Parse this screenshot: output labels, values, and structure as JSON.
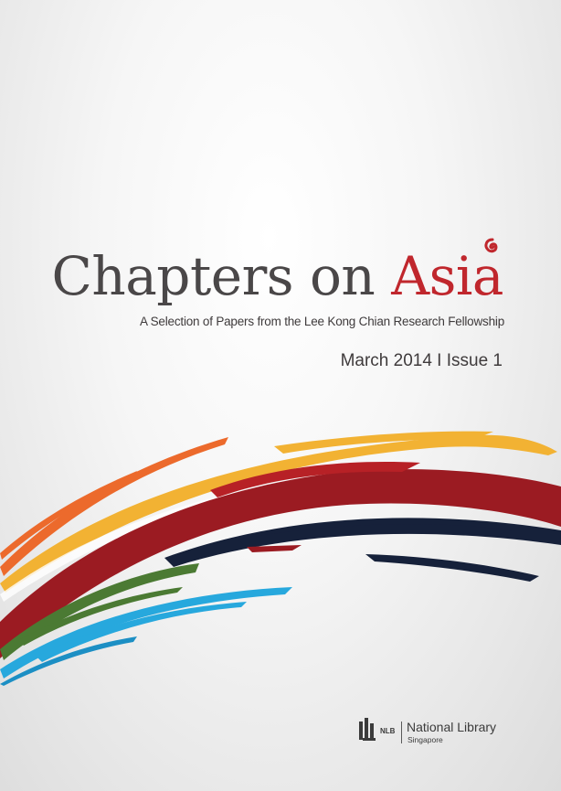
{
  "cover": {
    "title_main": "Chapters on ",
    "title_accent": "Asia",
    "subtitle": "A Selection of Papers from the Lee Kong Chian Research Fellowship",
    "issue": "March 2014 I Issue 1"
  },
  "publisher": {
    "abbreviation": "NLB",
    "name": "National Library",
    "location": "Singapore"
  },
  "colors": {
    "title": "#4a4748",
    "accent": "#c0272d",
    "brush_red": "#9b1b22",
    "brush_navy": "#16213a",
    "brush_orange": "#ec6a2c",
    "brush_yellow": "#f2b233",
    "brush_green": "#4b7a33",
    "brush_cyan": "#27a8dd"
  },
  "icons": {
    "swirl": "swirl-icon",
    "logo": "nlb-logo-icon"
  }
}
